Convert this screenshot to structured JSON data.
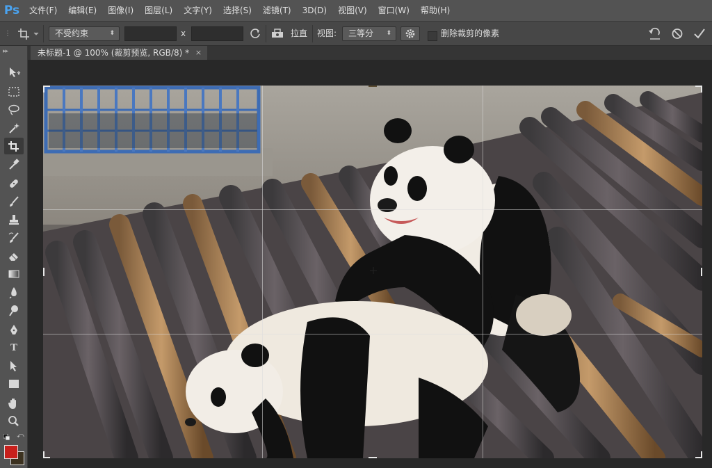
{
  "app": {
    "logo": "Ps"
  },
  "menu": [
    "文件(F)",
    "编辑(E)",
    "图像(I)",
    "图层(L)",
    "文字(Y)",
    "选择(S)",
    "滤镜(T)",
    "3D(D)",
    "视图(V)",
    "窗口(W)",
    "帮助(H)"
  ],
  "options": {
    "ratio_preset": "不受约束",
    "width_value": "",
    "height_value": "",
    "x_label": "x",
    "straighten_label": "拉直",
    "view_label": "视图:",
    "view_value": "三等分",
    "delete_pixels_label": "删除裁剪的像素",
    "delete_pixels_checked": false
  },
  "document": {
    "tab_title": "未标题-1 @ 100% (裁剪预览, RGB/8) *",
    "close_glyph": "×"
  },
  "colors": {
    "foreground": "#c8201c",
    "background": "#3c3220",
    "logo": "#4aa3f0"
  }
}
